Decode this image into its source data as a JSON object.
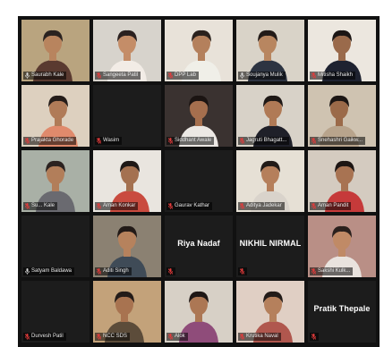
{
  "meeting": {
    "participants": [
      {
        "name": "Saurabh Kale",
        "muted": false,
        "active": true,
        "video": true,
        "bg": "#b9a47f",
        "skin": "#b8845e",
        "hair": "#2a2220",
        "shirt": "#5a3a30"
      },
      {
        "name": "Sangeeta Patil",
        "muted": true,
        "active": false,
        "video": true,
        "bg": "#d7d3cc",
        "skin": "#c48d68",
        "hair": "#2b2120",
        "shirt": "#f2ece6"
      },
      {
        "name": "DPP Lab",
        "muted": true,
        "active": false,
        "video": true,
        "bg": "#e8e2d9",
        "skin": "#b4805c",
        "hair": "#2a211d",
        "shirt": "#f0efe8"
      },
      {
        "name": "Soujanya Mulik",
        "muted": false,
        "active": false,
        "video": true,
        "bg": "#d9d3c8",
        "skin": "#b88660",
        "hair": "#231b18",
        "shirt": "#2d3442"
      },
      {
        "name": "Mitisha Shaikh",
        "muted": true,
        "active": false,
        "video": true,
        "bg": "#ece7df",
        "skin": "#9a6a4b",
        "hair": "#1b1514",
        "shirt": "#1e2230"
      },
      {
        "name": "Prajakta Ghorade",
        "muted": true,
        "active": false,
        "video": true,
        "bg": "#ddd0bf",
        "skin": "#b07b58",
        "hair": "#241c19",
        "shirt": "#e08a6c"
      },
      {
        "name": "Wasim",
        "muted": true,
        "active": false,
        "video": false
      },
      {
        "name": "Siddhant Awale",
        "muted": true,
        "active": false,
        "video": true,
        "bg": "#3a3230",
        "skin": "#a56f4e",
        "hair": "#1b1412",
        "shirt": "#ece8e4"
      },
      {
        "name": "Jagruti Bhagatt...",
        "muted": true,
        "active": false,
        "video": true,
        "bg": "#d8d2c8",
        "skin": "#b07a56",
        "hair": "#1e1816",
        "shirt": "#1f2029"
      },
      {
        "name": "Snehashri Gaikw...",
        "muted": true,
        "active": false,
        "video": true,
        "bg": "#cfc3b1",
        "skin": "#9b6a49",
        "hair": "#1c1614",
        "shirt": "#b8a48c"
      },
      {
        "name": "Su... Kale",
        "muted": true,
        "active": false,
        "video": true,
        "bg": "#a9b0a6",
        "skin": "#b27e5a",
        "hair": "#2b2220",
        "shirt": "#6a6a70"
      },
      {
        "name": "Aman Konkar",
        "muted": true,
        "active": false,
        "video": true,
        "bg": "#e9e5df",
        "skin": "#a47150",
        "hair": "#1e1816",
        "shirt": "#c94b3f"
      },
      {
        "name": "Gaurav Kathar",
        "muted": true,
        "active": false,
        "video": false
      },
      {
        "name": "Aditya Jadekar",
        "muted": true,
        "active": false,
        "video": true,
        "bg": "#e6e0d5",
        "skin": "#b57f5b",
        "hair": "#211a17",
        "shirt": "#d9d3cb"
      },
      {
        "name": "Aman Pandit",
        "muted": true,
        "active": false,
        "video": true,
        "bg": "#d4cbc0",
        "skin": "#a87352",
        "hair": "#1c1513",
        "shirt": "#c63a3a"
      },
      {
        "name": "Satyam Baldawa",
        "muted": false,
        "active": false,
        "video": false
      },
      {
        "name": "Aditi Singh",
        "muted": true,
        "active": false,
        "video": true,
        "bg": "#8b8172",
        "skin": "#b6825d",
        "hair": "#221a17",
        "shirt": "#3f4b57"
      },
      {
        "name": "Riya Nadaf",
        "muted": true,
        "active": false,
        "video": false,
        "big": true
      },
      {
        "name": "NIKHIL NIRMAL",
        "muted": true,
        "active": false,
        "video": false,
        "big": true
      },
      {
        "name": "Sakshi Kulk...",
        "muted": true,
        "active": false,
        "video": true,
        "bg": "#b98f86",
        "skin": "#c08a66",
        "hair": "#2a201d",
        "shirt": "#e9e3de"
      },
      {
        "name": "Durvesh Patil",
        "muted": true,
        "active": false,
        "video": false
      },
      {
        "name": "NCC SDS",
        "muted": true,
        "active": false,
        "video": true,
        "bg": "#c3a27a",
        "skin": "#a87350",
        "hair": "#231b18",
        "shirt": "#5c4c3a"
      },
      {
        "name": "Alok",
        "muted": true,
        "active": false,
        "video": true,
        "bg": "#d7d0c6",
        "skin": "#ac7754",
        "hair": "#1e1715",
        "shirt": "#8f4c7a"
      },
      {
        "name": "Krutika Naval",
        "muted": true,
        "active": false,
        "video": true,
        "bg": "#e0cfc4",
        "skin": "#b5805c",
        "hair": "#221b18",
        "shirt": "#b0574e"
      },
      {
        "name": "Pratik Thepale",
        "muted": true,
        "active": false,
        "video": false,
        "big": true
      }
    ]
  },
  "colors": {
    "active_border": "#d6d34a",
    "muted_icon": "#e23b3b",
    "tile_bg": "#1c1c1c"
  }
}
